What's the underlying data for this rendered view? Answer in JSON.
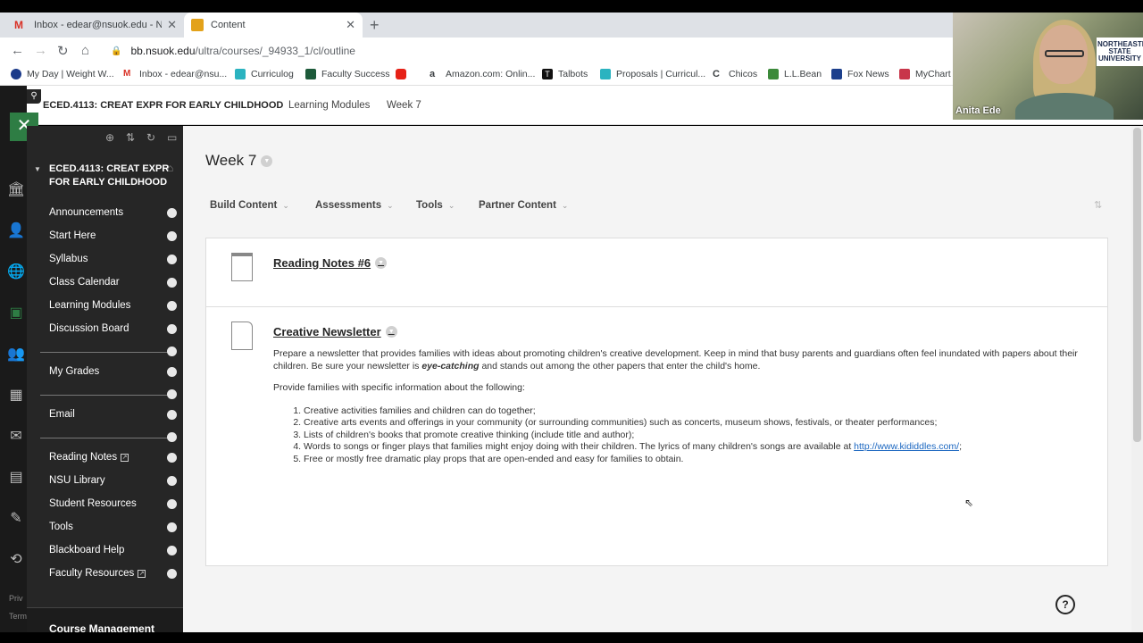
{
  "browser": {
    "tabs": [
      {
        "label": "Inbox - edear@nsuok.edu - NSU",
        "active": false
      },
      {
        "label": "Content",
        "active": true
      }
    ],
    "url_host": "bb.nsuok.edu",
    "url_path": "/ultra/courses/_94933_1/cl/outline",
    "bookmarks": [
      "My Day | Weight W...",
      "Inbox - edear@nsu...",
      "Curriculog",
      "Faculty Success",
      "",
      "Amazon.com: Onlin...",
      "Talbots",
      "Proposals | Curricul...",
      "Chicos",
      "L.L.Bean",
      "Fox News",
      "MyChart"
    ]
  },
  "header": {
    "course": "ECED.4113: CREAT EXPR FOR EARLY CHILDHOOD",
    "crumbs": [
      "Learning Modules",
      "Week 7"
    ]
  },
  "sidebar": {
    "course_title": "ECED.4113: CREAT EXPR FOR EARLY CHILDHOOD",
    "items": [
      "Announcements",
      "Start Here",
      "Syllabus",
      "Class Calendar",
      "Learning Modules",
      "Discussion Board",
      "My Grades",
      "Email",
      "Reading Notes",
      "NSU Library",
      "Student Resources",
      "Tools",
      "Blackboard Help",
      "Faculty Resources"
    ],
    "footer": "Course Management"
  },
  "rail": {
    "privacy": "Priv",
    "terms": "Term"
  },
  "main": {
    "title": "Week 7",
    "actions": [
      "Build Content",
      "Assessments",
      "Tools",
      "Partner Content"
    ],
    "items": [
      {
        "title": "Reading Notes #6"
      },
      {
        "title": "Creative Newsletter",
        "para1_a": "Prepare a newsletter that provides families with ideas about promoting children's creative development. Keep in mind that busy parents and guardians often feel inundated with papers about their children.  Be sure your newsletter is ",
        "para1_em": "eye-catching",
        "para1_b": " and stands out among the other papers that enter the child's home.",
        "para2": "Provide families with specific information about the following:",
        "list": [
          "Creative activities families and children can do together;",
          "Creative arts events and offerings in your community (or surrounding communities) such as concerts, museum shows, festivals, or theater performances;",
          "Lists of children's books that promote creative thinking (include title and author);",
          "Words to songs or finger plays that families might enjoy doing with their children. The lyrics of many children's songs are available at ",
          "Free or mostly free dramatic play props that are open-ended and easy for families to obtain."
        ],
        "link": "http://www.kididdles.com/",
        "link_suffix": ";"
      }
    ]
  },
  "video": {
    "name": "Anita Ede",
    "logo": "NORTHEASTERN STATE UNIVERSITY"
  },
  "colors": {
    "accent_green": "#2e7d44",
    "sidebar_bg": "#262626",
    "link": "#1a66c0"
  }
}
